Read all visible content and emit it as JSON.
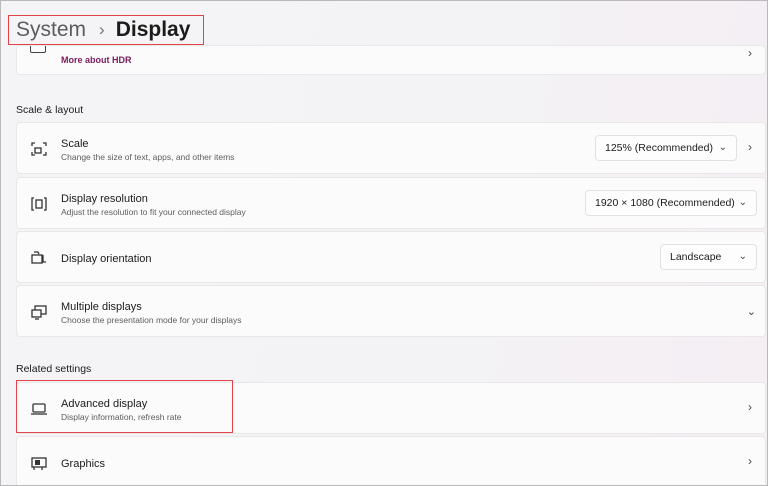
{
  "breadcrumb": {
    "parent": "System",
    "separator": "›",
    "current": "Display"
  },
  "hdr_card": {
    "link": "More about HDR"
  },
  "sections": {
    "scale_layout": "Scale & layout",
    "related": "Related settings"
  },
  "rows": {
    "scale": {
      "title": "Scale",
      "subtitle": "Change the size of text, apps, and other items",
      "value": "125% (Recommended)"
    },
    "resolution": {
      "title": "Display resolution",
      "subtitle": "Adjust the resolution to fit your connected display",
      "value": "1920 × 1080 (Recommended)"
    },
    "orientation": {
      "title": "Display orientation",
      "value": "Landscape"
    },
    "multiple": {
      "title": "Multiple displays",
      "subtitle": "Choose the presentation mode for your displays"
    },
    "advanced": {
      "title": "Advanced display",
      "subtitle": "Display information, refresh rate"
    },
    "graphics": {
      "title": "Graphics"
    }
  },
  "icons": {
    "hdr": "hdr-icon",
    "scale": "scale-icon",
    "resolution": "resolution-icon",
    "orientation": "orientation-icon",
    "multiple": "multiple-displays-icon",
    "advanced": "monitor-icon",
    "graphics": "graphics-card-icon",
    "chevron_right": "chevron-right-icon",
    "chevron_down": "chevron-down-icon"
  },
  "colors": {
    "highlight": "#e0434a",
    "link": "#7a1a5d"
  }
}
